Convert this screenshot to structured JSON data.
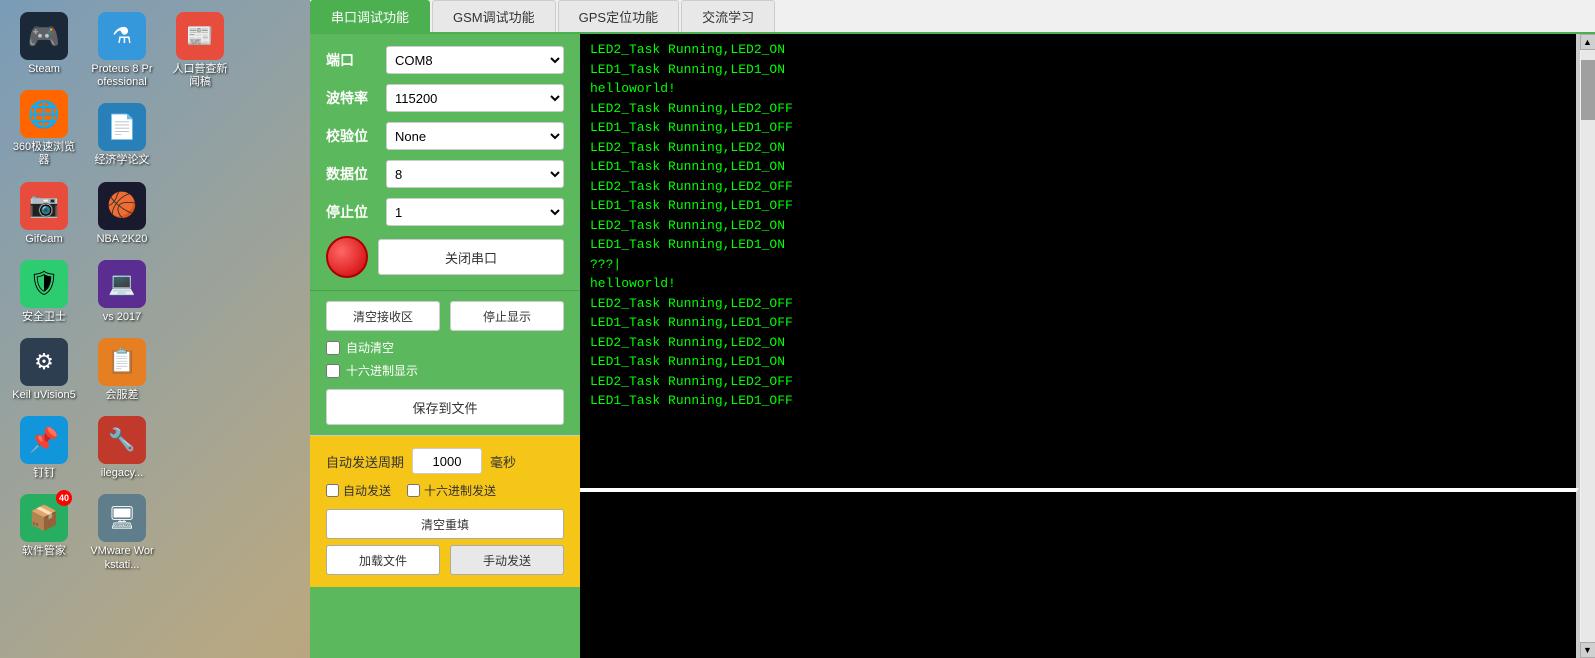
{
  "desktop": {
    "background": "blurred orange/blue cards"
  },
  "icons": [
    {
      "id": "steam",
      "label": "Steam",
      "color": "#1b2838",
      "emoji": "🎮",
      "badge": null
    },
    {
      "id": "360",
      "label": "360极速浏览器",
      "color": "#fff",
      "emoji": "🌐",
      "badge": null
    },
    {
      "id": "gifcam",
      "label": "GifCam",
      "color": "#e74c3c",
      "emoji": "📷",
      "badge": null
    },
    {
      "id": "anquan",
      "label": "安全卫士",
      "color": "#2ecc71",
      "emoji": "🛡",
      "badge": null
    },
    {
      "id": "keil",
      "label": "Keil uVision5",
      "color": "#2c3e50",
      "emoji": "⚙",
      "badge": null
    },
    {
      "id": "dingding",
      "label": "钉钉",
      "color": "#1296db",
      "emoji": "📌",
      "badge": null
    },
    {
      "id": "software",
      "label": "软件管家",
      "color": "#27ae60",
      "emoji": "📦",
      "badge": "40"
    },
    {
      "id": "proteus",
      "label": "Proteus 8 Professional",
      "color": "#3498db",
      "emoji": "⚗",
      "badge": null
    },
    {
      "id": "jingji",
      "label": "经济学论文",
      "color": "#2980b9",
      "emoji": "📄",
      "badge": null
    },
    {
      "id": "nba",
      "label": "NBA 2K20",
      "color": "#1a1a2e",
      "emoji": "🏀",
      "badge": null
    },
    {
      "id": "vs",
      "label": "vs 2017",
      "color": "#5c2d91",
      "emoji": "💻",
      "badge": null
    },
    {
      "id": "huifu",
      "label": "会服差",
      "color": "#e67e22",
      "emoji": "📋",
      "badge": null
    },
    {
      "id": "ilegacy",
      "label": "ilegacy...",
      "color": "#c0392b",
      "emoji": "🔧",
      "badge": null
    },
    {
      "id": "vmware",
      "label": "VMware Workstati...",
      "color": "#607d8b",
      "emoji": "🖥",
      "badge": null
    },
    {
      "id": "renkou",
      "label": "人口普查新闻稿",
      "color": "#e74c3c",
      "emoji": "📰",
      "badge": null
    }
  ],
  "app": {
    "tabs": [
      {
        "id": "serial",
        "label": "串口调试功能",
        "active": true
      },
      {
        "id": "gsm",
        "label": "GSM调试功能",
        "active": false
      },
      {
        "id": "gps",
        "label": "GPS定位功能",
        "active": false
      },
      {
        "id": "ac",
        "label": "交流学习",
        "active": false
      }
    ],
    "config": {
      "port_label": "端口",
      "port_value": "COM8",
      "baud_label": "波特率",
      "baud_value": "115200",
      "parity_label": "校验位",
      "parity_value": "None",
      "databits_label": "数据位",
      "databits_value": "8",
      "stopbits_label": "停止位",
      "stopbits_value": "1",
      "close_port_btn": "关闭串口"
    },
    "receive": {
      "clear_btn": "清空接收区",
      "stop_btn": "停止显示",
      "auto_clear_label": "自动清空",
      "hex_display_label": "十六进制显示",
      "save_btn": "保存到文件"
    },
    "send": {
      "period_label": "自动发送周期",
      "period_value": "1000",
      "period_unit": "毫秒",
      "auto_send_label": "自动发送",
      "hex_send_label": "十六进制发送",
      "clear_btn": "清空重填",
      "load_btn": "加载文件",
      "manual_btn": "手动发送"
    },
    "terminal": {
      "lines": [
        "LED2_Task Running,LED2_ON",
        "LED1_Task Running,LED1_ON",
        "helloworld!",
        "LED2_Task Running,LED2_OFF",
        "LED1_Task Running,LED1_OFF",
        "LED2_Task Running,LED2_ON",
        "LED1_Task Running,LED1_ON",
        "LED2_Task Running,LED2_OFF",
        "LED1_Task Running,LED1_OFF",
        "LED2_Task Running,LED2_ON",
        "LED1_Task Running,LED1_ON",
        "???|",
        "helloworld!",
        "LED2_Task Running,LED2_OFF",
        "LED1_Task Running,LED1_OFF",
        "LED2_Task Running,LED2_ON",
        "LED1_Task Running,LED1_ON",
        "LED2_Task Running,LED2_OFF",
        "LED1_Task Running,LED1_OFF"
      ]
    }
  }
}
